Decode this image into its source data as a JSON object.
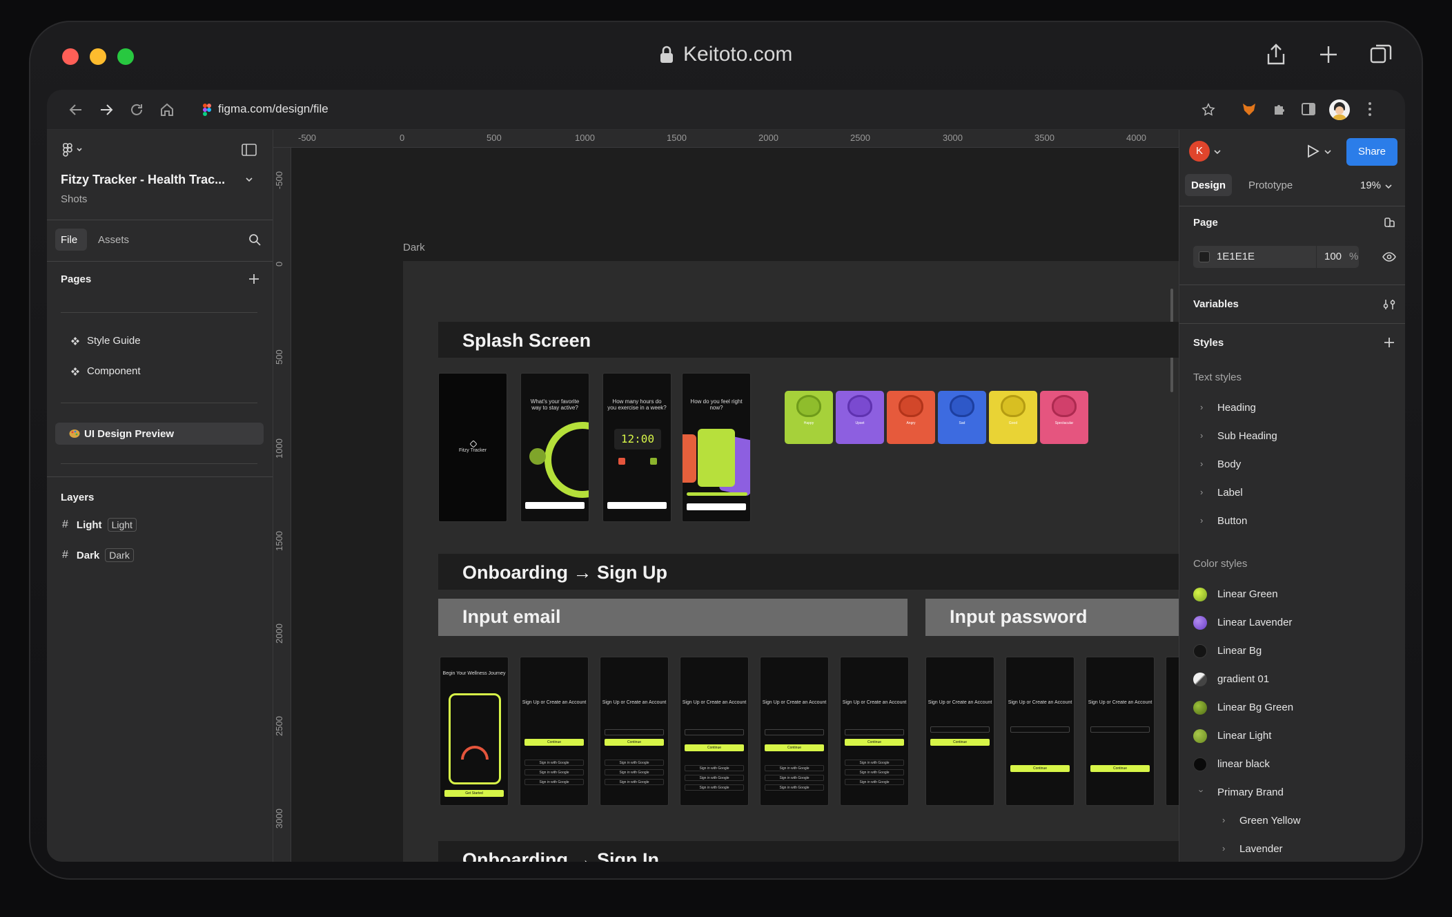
{
  "window": {
    "domain": "Keitoto.com"
  },
  "browser": {
    "url": "figma.com/design/file"
  },
  "file": {
    "name": "Fitzy Tracker - Health Trac...",
    "subtitle": "Shots",
    "tabs": [
      "File",
      "Assets"
    ],
    "pages_label": "Pages",
    "pages": [
      "Style Guide",
      "Component",
      "UI Design Preview"
    ],
    "layers_label": "Layers",
    "layers": [
      {
        "name": "Light",
        "badge": "Light"
      },
      {
        "name": "Dark",
        "badge": "Dark"
      }
    ]
  },
  "toolbar": {
    "avatar_letter": "K",
    "share_label": "Share",
    "zoom": "19%"
  },
  "right": {
    "tabs": [
      "Design",
      "Prototype"
    ],
    "page_label": "Page",
    "page_color": "1E1E1E",
    "page_opacity": "100",
    "percent": "%",
    "variables_label": "Variables",
    "styles_label": "Styles",
    "text_styles_label": "Text styles",
    "text_styles": [
      "Heading",
      "Sub Heading",
      "Body",
      "Label",
      "Button"
    ],
    "color_styles_label": "Color styles",
    "color_styles": [
      {
        "name": "Linear Green",
        "color": "#a5cf3a"
      },
      {
        "name": "Linear Lavender",
        "color": "#8a5be0"
      },
      {
        "name": "Linear Bg",
        "color": "#151515"
      },
      {
        "name": "gradient 01",
        "color": "#d9d9d9"
      },
      {
        "name": "Linear Bg Green",
        "color": "#6f8f22"
      },
      {
        "name": "Linear Light",
        "color": "#8aa93a"
      },
      {
        "name": "linear black",
        "color": "#0a0a0a"
      }
    ],
    "primary_brand": "Primary Brand",
    "brand_children": [
      "Green Yellow",
      "Lavender"
    ]
  },
  "canvas": {
    "ruler_x": [
      "-500",
      "0",
      "500",
      "1000",
      "1500",
      "2000",
      "2500",
      "3000",
      "3500",
      "4000"
    ],
    "ruler_y": [
      "-500",
      "0",
      "500",
      "1000",
      "1500",
      "2000",
      "2500",
      "3000"
    ],
    "frame_label": "Dark",
    "sections": {
      "splash": "Splash Screen",
      "signup": "Onboarding → Sign Up",
      "signin": "Onboarding → Sign In",
      "input_email": "Input email",
      "input_password": "Input password"
    },
    "splash_phones": [
      {
        "title": "Fitzy Tracker"
      },
      {
        "title": "What's your favorite way to stay active?"
      },
      {
        "title": "How many hours do you exercise in a week?",
        "clock": "12:00"
      },
      {
        "title": "How do you feel right now?"
      }
    ],
    "moods": [
      {
        "label": "Happy",
        "color": "#a6d13a"
      },
      {
        "label": "Upset",
        "color": "#8d5fe0"
      },
      {
        "label": "Angry",
        "color": "#e65a3c"
      },
      {
        "label": "Sad",
        "color": "#3d6be0"
      },
      {
        "label": "Good",
        "color": "#e9d335"
      },
      {
        "label": "Spectacular",
        "color": "#e5557f"
      }
    ],
    "signup_first": "Begin Your Wellness Journey",
    "signup_title": "Sign Up or Create an Account",
    "continue": "Continue",
    "google": "Sign in with Google",
    "get_started": "Get Started"
  },
  "colors": {
    "accent": "#d7f548",
    "share": "#2b7de9",
    "avatar": "#e0452c"
  }
}
